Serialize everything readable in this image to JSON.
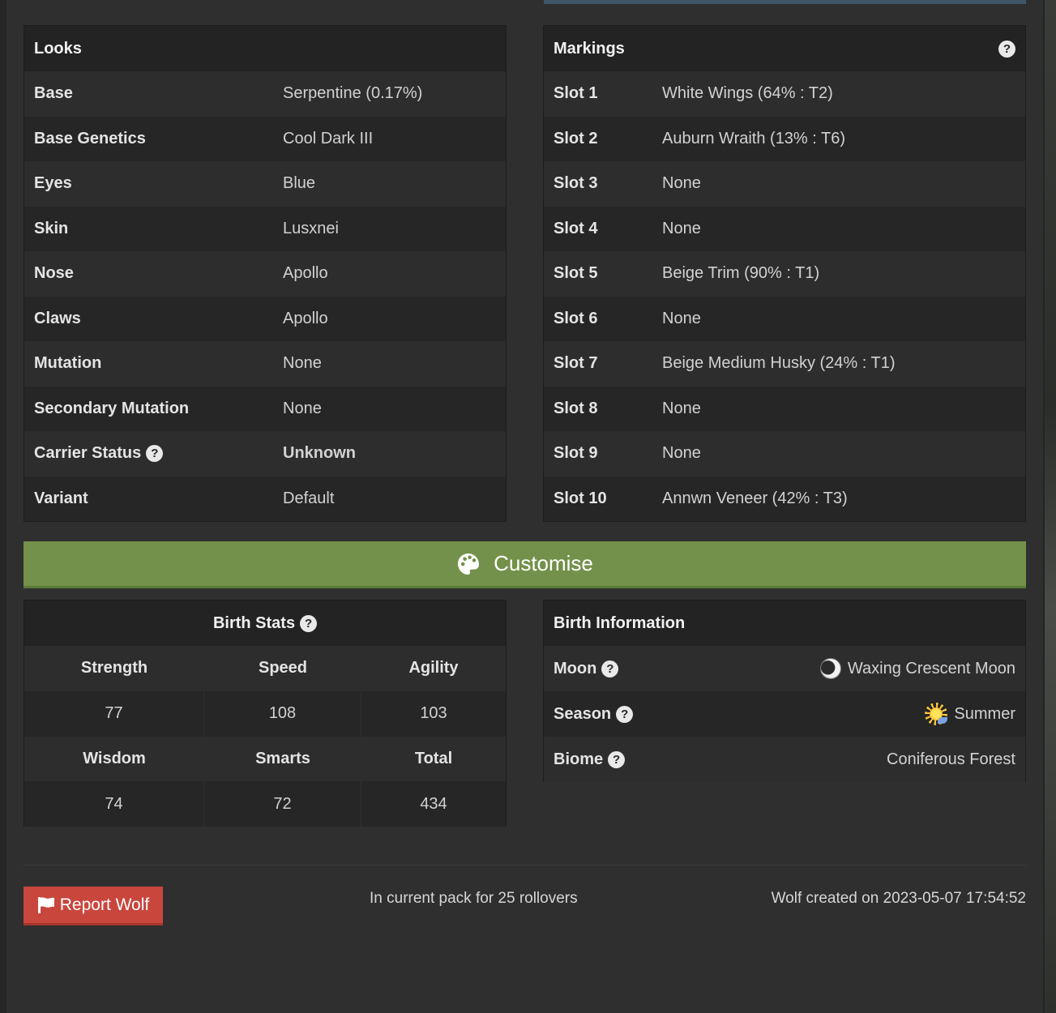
{
  "looks": {
    "title": "Looks",
    "rows": [
      {
        "label": "Base",
        "value": "Serpentine (0.17%)"
      },
      {
        "label": "Base Genetics",
        "value": "Cool Dark III"
      },
      {
        "label": "Eyes",
        "value": "Blue"
      },
      {
        "label": "Skin",
        "value": "Lusxnei"
      },
      {
        "label": "Nose",
        "value": "Apollo"
      },
      {
        "label": "Claws",
        "value": "Apollo"
      },
      {
        "label": "Mutation",
        "value": "None"
      },
      {
        "label": "Secondary Mutation",
        "value": "None"
      },
      {
        "label": "Carrier Status",
        "value": "Unknown"
      },
      {
        "label": "Variant",
        "value": "Default"
      }
    ]
  },
  "markings": {
    "title": "Markings",
    "rows": [
      {
        "label": "Slot 1",
        "value": "White Wings (64% : T2)"
      },
      {
        "label": "Slot 2",
        "value": "Auburn Wraith (13% : T6)"
      },
      {
        "label": "Slot 3",
        "value": "None"
      },
      {
        "label": "Slot 4",
        "value": "None"
      },
      {
        "label": "Slot 5",
        "value": "Beige Trim (90% : T1)"
      },
      {
        "label": "Slot 6",
        "value": "None"
      },
      {
        "label": "Slot 7",
        "value": "Beige Medium Husky (24% : T1)"
      },
      {
        "label": "Slot 8",
        "value": "None"
      },
      {
        "label": "Slot 9",
        "value": "None"
      },
      {
        "label": "Slot 10",
        "value": "Annwn Veneer (42% : T3)"
      }
    ]
  },
  "customise": {
    "label": "Customise",
    "icon": "palette-icon"
  },
  "birth_stats": {
    "title": "Birth Stats",
    "headers_1": [
      "Strength",
      "Speed",
      "Agility"
    ],
    "values_1": [
      "77",
      "108",
      "103"
    ],
    "headers_2": [
      "Wisdom",
      "Smarts",
      "Total"
    ],
    "values_2": [
      "74",
      "72",
      "434"
    ]
  },
  "birth_info": {
    "title": "Birth Information",
    "moon_label": "Moon",
    "moon_value": "Waxing Crescent Moon",
    "season_label": "Season",
    "season_value": "Summer",
    "biome_label": "Biome",
    "biome_value": "Coniferous Forest"
  },
  "footer": {
    "report_label": "Report Wolf",
    "rollovers": "In current pack for 25 rollovers",
    "created": "Wolf created on 2023-05-07 17:54:52"
  },
  "colors": {
    "background": "#2f2f2f",
    "panel": "#262626",
    "customise": "#73914a",
    "report": "#c9463d",
    "link": "#8aa7c8"
  }
}
